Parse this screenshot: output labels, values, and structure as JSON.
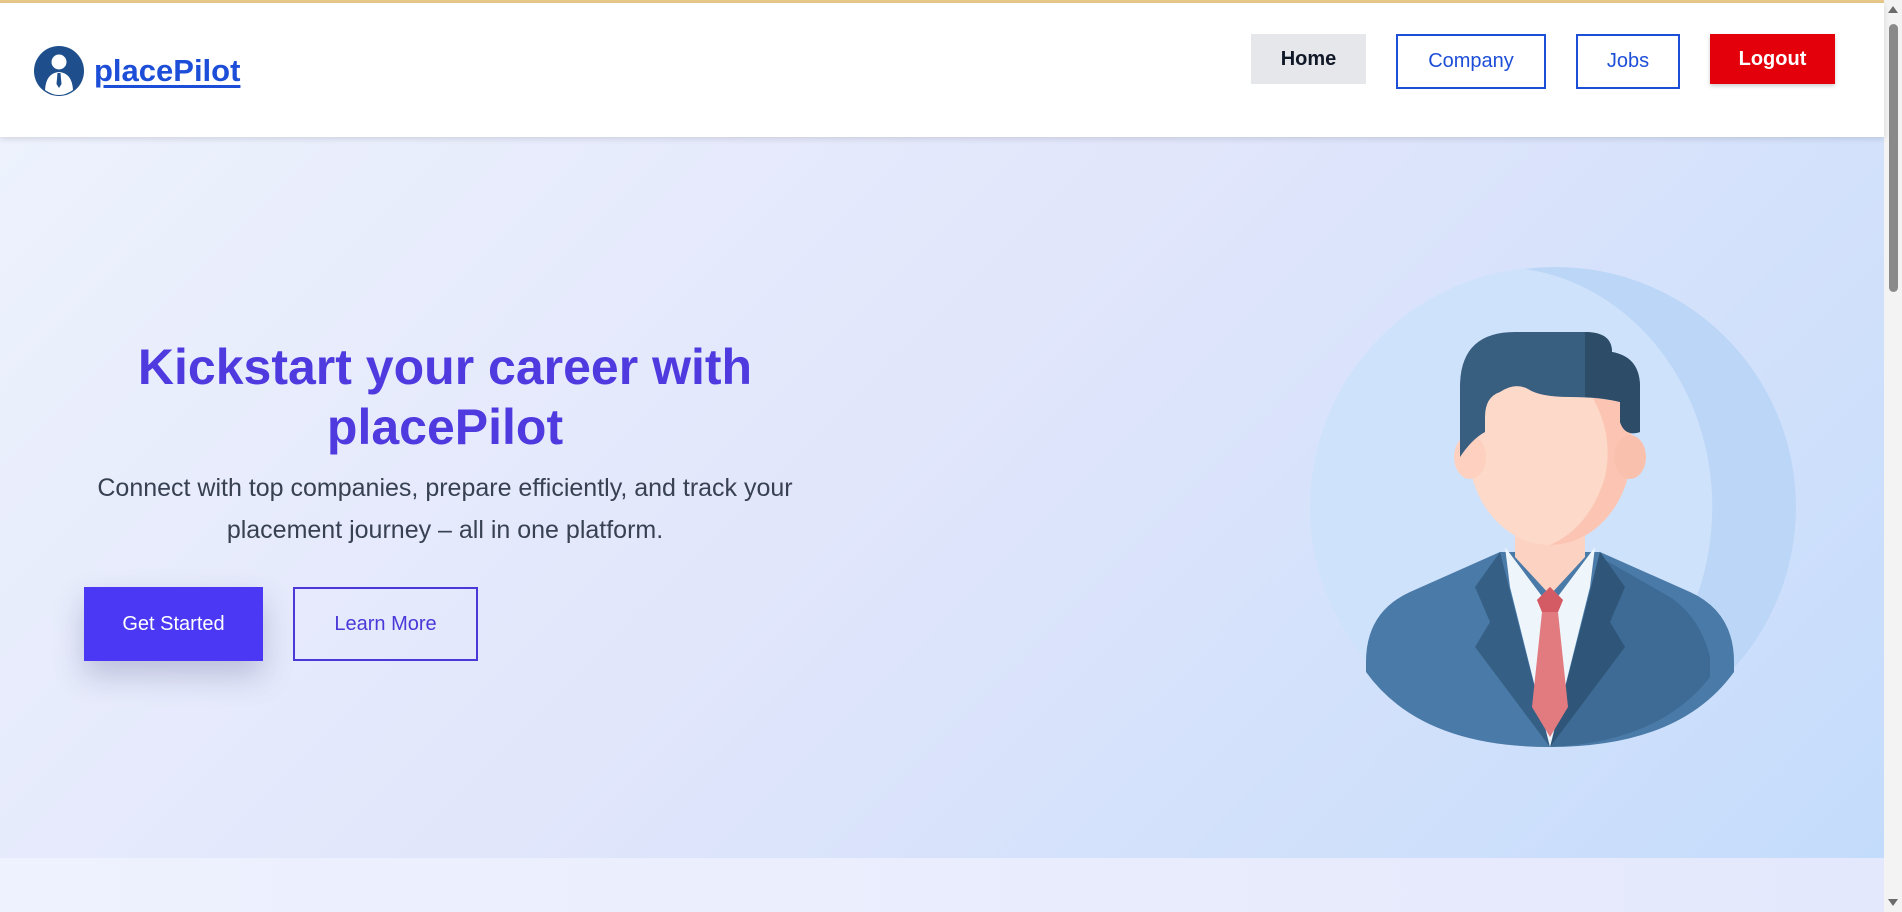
{
  "brand": {
    "name": "placePilot",
    "logo_icon": "user-tie-icon"
  },
  "nav": {
    "home": "Home",
    "company": "Company",
    "jobs": "Jobs",
    "logout": "Logout"
  },
  "hero": {
    "title": "Kickstart your career with placePilot",
    "subtitle": "Connect with top companies, prepare efficiently, and track your placement journey – all in one platform.",
    "primary_button": "Get Started",
    "secondary_button": "Learn More",
    "illustration": "businessman-avatar-icon"
  },
  "colors": {
    "accent": "#4b38f5",
    "brand_blue": "#1d4ed8",
    "logout_red": "#e3000b"
  }
}
